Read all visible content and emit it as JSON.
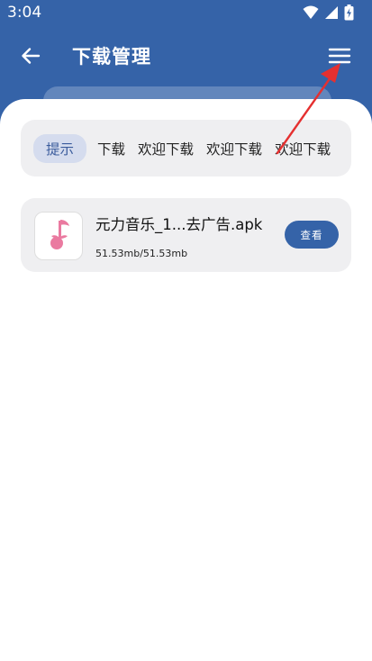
{
  "status_bar": {
    "time": "3:04",
    "icons": [
      "wifi-icon",
      "signal-icon",
      "battery-icon"
    ]
  },
  "app_bar": {
    "title": "下载管理",
    "back_icon": "back-arrow-icon",
    "menu_icon": "menu-icon"
  },
  "tabs": [
    {
      "label": "提示",
      "active": true
    },
    {
      "label": "下载",
      "active": false
    },
    {
      "label": "欢迎下载",
      "active": false
    },
    {
      "label": "欢迎下载",
      "active": false
    },
    {
      "label": "欢迎下载",
      "active": false
    }
  ],
  "downloads": [
    {
      "name": "元力音乐_1...去广告.apk",
      "size": "51.53mb/51.53mb",
      "action_label": "查看",
      "icon": "music-note-app-icon"
    }
  ],
  "colors": {
    "primary": "#3563a8",
    "card_bg": "#efeff1",
    "tab_active_bg": "#d5dcee",
    "tab_active_text": "#3a5b9c",
    "annotation": "#e53030",
    "app_icon_pink": "#ea7aa0"
  }
}
